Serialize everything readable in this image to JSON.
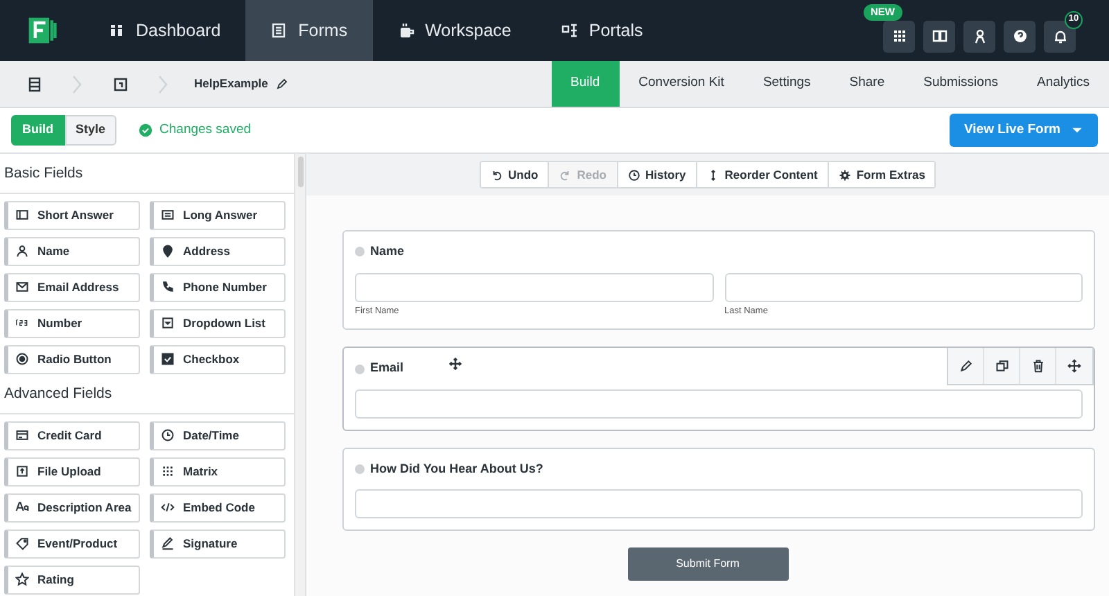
{
  "nav": {
    "items": [
      {
        "label": "Dashboard",
        "selected": false
      },
      {
        "label": "Forms",
        "selected": true
      },
      {
        "label": "Workspace",
        "selected": false
      },
      {
        "label": "Portals",
        "selected": false
      }
    ],
    "new_badge": "NEW",
    "notification_count": "10"
  },
  "breadcrumb": {
    "form_name": "HelpExample"
  },
  "tabs": [
    {
      "label": "Build",
      "selected": true
    },
    {
      "label": "Conversion Kit",
      "selected": false
    },
    {
      "label": "Settings",
      "selected": false
    },
    {
      "label": "Share",
      "selected": false
    },
    {
      "label": "Submissions",
      "selected": false
    },
    {
      "label": "Analytics",
      "selected": false
    }
  ],
  "mode_toggle": [
    {
      "label": "Build",
      "selected": true
    },
    {
      "label": "Style",
      "selected": false
    }
  ],
  "save_status": "Changes saved",
  "view_button": "View Live Form",
  "sidebar": {
    "sections": [
      {
        "title": "Basic Fields",
        "items": [
          "Short Answer",
          "Long Answer",
          "Name",
          "Address",
          "Email Address",
          "Phone Number",
          "Number",
          "Dropdown List",
          "Radio Button",
          "Checkbox"
        ]
      },
      {
        "title": "Advanced Fields",
        "items": [
          "Credit Card",
          "Date/Time",
          "File Upload",
          "Matrix",
          "Description Area",
          "Embed Code",
          "Event/Product",
          "Signature",
          "Rating"
        ]
      }
    ]
  },
  "toolbar": [
    {
      "label": "Undo",
      "disabled": false
    },
    {
      "label": "Redo",
      "disabled": true
    },
    {
      "label": "History",
      "disabled": false
    },
    {
      "label": "Reorder Content",
      "disabled": false
    },
    {
      "label": "Form Extras",
      "disabled": false
    }
  ],
  "form": {
    "fields": [
      {
        "kind": "name",
        "label": "Name",
        "sublabels": [
          "First Name",
          "Last Name"
        ],
        "hovered": false
      },
      {
        "kind": "single",
        "label": "Email",
        "hovered": true
      },
      {
        "kind": "single",
        "label": "How Did You Hear About Us?",
        "hovered": false
      }
    ],
    "submit": "Submit Form"
  }
}
